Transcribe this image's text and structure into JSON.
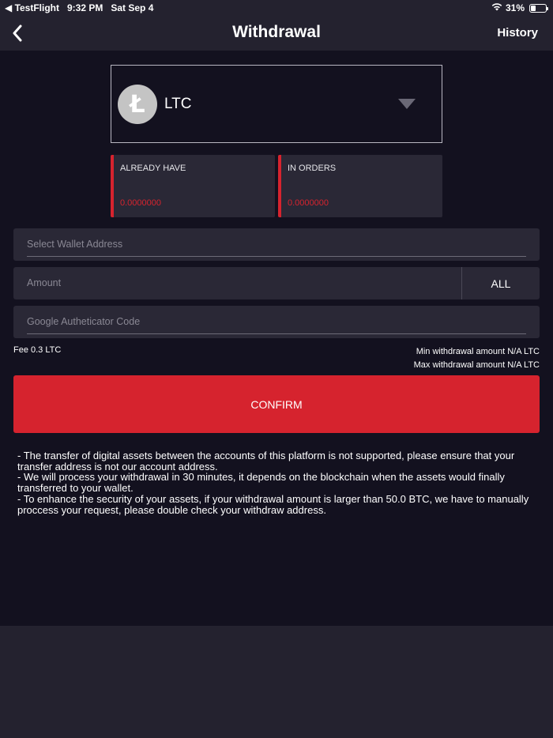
{
  "status_bar": {
    "back_app": "◀ TestFlight",
    "time": "9:32 PM",
    "date": "Sat Sep 4",
    "battery_percent": "31%",
    "battery_level": 0.31
  },
  "nav": {
    "title": "Withdrawal",
    "history_label": "History"
  },
  "coin": {
    "symbol": "LTC",
    "logo_letter": "Ł"
  },
  "balances": [
    {
      "label": "ALREADY HAVE",
      "value": "0.0000000"
    },
    {
      "label": "IN ORDERS",
      "value": "0.0000000"
    }
  ],
  "fields": {
    "wallet_placeholder": "Select Wallet Address",
    "amount_placeholder": "Amount",
    "all_label": "ALL",
    "authenticator_placeholder": "Google Autheticator Code"
  },
  "fee_text": "Fee 0.3 LTC",
  "min_withdrawal": "Min withdrawal amount N/A LTC",
  "max_withdrawal": "Max withdrawal amount N/A LTC",
  "confirm_label": "CONFIRM",
  "notes": [
    "- The transfer of digital assets between the accounts of this platform is not supported, please ensure that your transfer address is not our account address.",
    "- We will process your withdrawal in 30 minutes, it depends on the blockchain when the assets would finally transferred to your wallet.",
    "- To enhance the security of your assets, if your withdrawal amount is larger than 50.0 BTC, we have to manually proccess your request, please double check your withdraw address."
  ],
  "colors": {
    "accent_red": "#d6232e",
    "background": "#13111f",
    "panel": "#2a2836"
  }
}
